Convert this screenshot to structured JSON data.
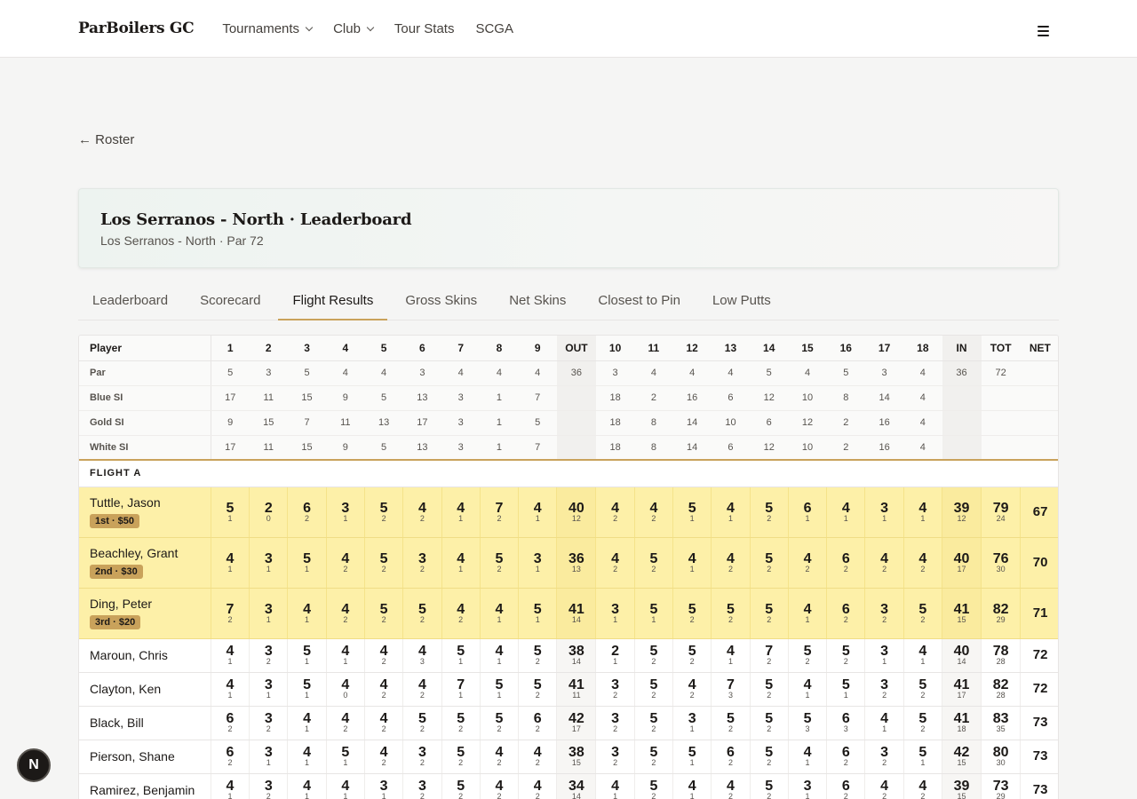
{
  "nav": {
    "brand": "ParBoilers GC",
    "items": [
      {
        "label": "Tournaments",
        "dropdown": true
      },
      {
        "label": "Club",
        "dropdown": true
      },
      {
        "label": "Tour Stats",
        "dropdown": false
      },
      {
        "label": "SCGA",
        "dropdown": false
      }
    ],
    "menu_icon": "hamburger-icon"
  },
  "back_link": "← Roster",
  "header": {
    "title": "Los Serranos - North · Leaderboard",
    "subtitle": "Los Serranos - North · Par 72"
  },
  "tabs": [
    {
      "label": "Leaderboard",
      "active": false
    },
    {
      "label": "Scorecard",
      "active": false
    },
    {
      "label": "Flight Results",
      "active": true
    },
    {
      "label": "Gross Skins",
      "active": false
    },
    {
      "label": "Net Skins",
      "active": false
    },
    {
      "label": "Closest to Pin",
      "active": false
    },
    {
      "label": "Low Putts",
      "active": false
    }
  ],
  "table": {
    "columns": [
      "Player",
      "1",
      "2",
      "3",
      "4",
      "5",
      "6",
      "7",
      "8",
      "9",
      "OUT",
      "10",
      "11",
      "12",
      "13",
      "14",
      "15",
      "16",
      "17",
      "18",
      "IN",
      "TOT",
      "NET"
    ],
    "info_rows": [
      {
        "label": "Par",
        "values": [
          "5",
          "3",
          "5",
          "4",
          "4",
          "3",
          "4",
          "4",
          "4",
          "36",
          "3",
          "4",
          "4",
          "4",
          "5",
          "4",
          "5",
          "3",
          "4",
          "36",
          "72",
          ""
        ]
      },
      {
        "label": "Blue SI",
        "values": [
          "17",
          "11",
          "15",
          "9",
          "5",
          "13",
          "3",
          "1",
          "7",
          "",
          "18",
          "2",
          "16",
          "6",
          "12",
          "10",
          "8",
          "14",
          "4",
          "",
          "",
          ""
        ]
      },
      {
        "label": "Gold SI",
        "values": [
          "9",
          "15",
          "7",
          "11",
          "13",
          "17",
          "3",
          "1",
          "5",
          "",
          "18",
          "8",
          "14",
          "10",
          "6",
          "12",
          "2",
          "16",
          "4",
          "",
          "",
          ""
        ]
      },
      {
        "label": "White SI",
        "values": [
          "17",
          "11",
          "15",
          "9",
          "5",
          "13",
          "3",
          "1",
          "7",
          "",
          "18",
          "8",
          "14",
          "6",
          "12",
          "10",
          "2",
          "16",
          "4",
          "",
          "",
          ""
        ]
      }
    ],
    "flight_label": "FLIGHT A",
    "players": [
      {
        "name": "Tuttle, Jason",
        "badge": "1st · $50",
        "scores": [
          "5",
          "2",
          "6",
          "3",
          "5",
          "4",
          "4",
          "7",
          "4",
          "40",
          "4",
          "4",
          "5",
          "4",
          "5",
          "6",
          "4",
          "3",
          "4",
          "39",
          "79"
        ],
        "putts": [
          "1",
          "0",
          "2",
          "1",
          "2",
          "2",
          "1",
          "2",
          "1",
          "12",
          "2",
          "2",
          "1",
          "1",
          "2",
          "1",
          "1",
          "1",
          "1",
          "12",
          "24"
        ],
        "net": "67"
      },
      {
        "name": "Beachley, Grant",
        "badge": "2nd · $30",
        "scores": [
          "4",
          "3",
          "5",
          "4",
          "5",
          "3",
          "4",
          "5",
          "3",
          "36",
          "4",
          "5",
          "4",
          "4",
          "5",
          "4",
          "6",
          "4",
          "4",
          "40",
          "76"
        ],
        "putts": [
          "1",
          "1",
          "1",
          "2",
          "2",
          "2",
          "1",
          "2",
          "1",
          "13",
          "2",
          "2",
          "1",
          "2",
          "2",
          "2",
          "2",
          "2",
          "2",
          "17",
          "30"
        ],
        "net": "70"
      },
      {
        "name": "Ding, Peter",
        "badge": "3rd · $20",
        "scores": [
          "7",
          "3",
          "4",
          "4",
          "5",
          "5",
          "4",
          "4",
          "5",
          "41",
          "3",
          "5",
          "5",
          "5",
          "5",
          "4",
          "6",
          "3",
          "5",
          "41",
          "82"
        ],
        "putts": [
          "2",
          "1",
          "1",
          "2",
          "2",
          "2",
          "2",
          "1",
          "1",
          "14",
          "1",
          "1",
          "2",
          "2",
          "2",
          "1",
          "2",
          "2",
          "2",
          "15",
          "29"
        ],
        "net": "71"
      },
      {
        "name": "Maroun, Chris",
        "badge": "",
        "scores": [
          "4",
          "3",
          "5",
          "4",
          "4",
          "4",
          "5",
          "4",
          "5",
          "38",
          "2",
          "5",
          "5",
          "4",
          "7",
          "5",
          "5",
          "3",
          "4",
          "40",
          "78"
        ],
        "putts": [
          "1",
          "2",
          "1",
          "1",
          "2",
          "3",
          "1",
          "1",
          "2",
          "14",
          "1",
          "2",
          "2",
          "1",
          "2",
          "2",
          "2",
          "1",
          "1",
          "14",
          "28"
        ],
        "net": "72"
      },
      {
        "name": "Clayton, Ken",
        "badge": "",
        "scores": [
          "4",
          "3",
          "5",
          "4",
          "4",
          "4",
          "7",
          "5",
          "5",
          "41",
          "3",
          "5",
          "4",
          "7",
          "5",
          "4",
          "5",
          "3",
          "5",
          "41",
          "82"
        ],
        "putts": [
          "1",
          "1",
          "1",
          "0",
          "2",
          "2",
          "1",
          "1",
          "2",
          "11",
          "2",
          "2",
          "2",
          "3",
          "2",
          "1",
          "1",
          "2",
          "2",
          "17",
          "28"
        ],
        "net": "72"
      },
      {
        "name": "Black, Bill",
        "badge": "",
        "scores": [
          "6",
          "3",
          "4",
          "4",
          "4",
          "5",
          "5",
          "5",
          "6",
          "42",
          "3",
          "5",
          "3",
          "5",
          "5",
          "5",
          "6",
          "4",
          "5",
          "41",
          "83"
        ],
        "putts": [
          "2",
          "2",
          "1",
          "2",
          "2",
          "2",
          "2",
          "2",
          "2",
          "17",
          "2",
          "2",
          "1",
          "2",
          "2",
          "3",
          "3",
          "1",
          "2",
          "18",
          "35"
        ],
        "net": "73"
      },
      {
        "name": "Pierson, Shane",
        "badge": "",
        "scores": [
          "6",
          "3",
          "4",
          "5",
          "4",
          "3",
          "5",
          "4",
          "4",
          "38",
          "3",
          "5",
          "5",
          "6",
          "5",
          "4",
          "6",
          "3",
          "5",
          "42",
          "80"
        ],
        "putts": [
          "2",
          "1",
          "1",
          "1",
          "2",
          "2",
          "2",
          "2",
          "2",
          "15",
          "2",
          "2",
          "1",
          "2",
          "2",
          "1",
          "2",
          "2",
          "1",
          "15",
          "30"
        ],
        "net": "73"
      },
      {
        "name": "Ramirez, Benjamin",
        "badge": "",
        "scores": [
          "4",
          "3",
          "4",
          "4",
          "3",
          "3",
          "5",
          "4",
          "4",
          "34",
          "4",
          "5",
          "4",
          "4",
          "5",
          "3",
          "6",
          "4",
          "4",
          "39",
          "73"
        ],
        "putts": [
          "1",
          "2",
          "1",
          "1",
          "1",
          "2",
          "2",
          "2",
          "2",
          "14",
          "1",
          "2",
          "1",
          "2",
          "2",
          "1",
          "2",
          "2",
          "2",
          "15",
          "29"
        ],
        "net": "73"
      }
    ]
  },
  "floating_badge": "N",
  "colors": {
    "accent": "#c9a25b",
    "prize_row": "#fdf0a8",
    "text": "#1c1917"
  }
}
